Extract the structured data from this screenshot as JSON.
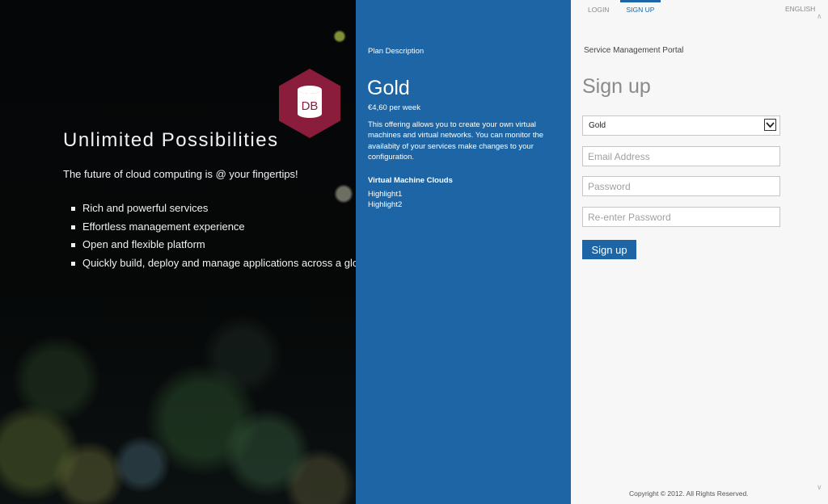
{
  "hero": {
    "badge": "DB",
    "title": "Unlimited Possibilities",
    "subtitle": "The future of cloud computing is @ your fingertips!",
    "features": [
      "Rich and powerful services",
      "Effortless management experience",
      "Open and flexible platform",
      "Quickly build, deploy and manage applications across a global"
    ]
  },
  "plan": {
    "section_label": "Plan Description",
    "name": "Gold",
    "price": "€4,60 per week",
    "description": "This offering allows you to create your own virtual machines and virtual networks. You can monitor the availabity of your services make changes to your configuration.",
    "feature_title": "Virtual Machine Clouds",
    "highlights": [
      "Highlight1",
      "Highlight2"
    ]
  },
  "nav": {
    "tabs": [
      {
        "label": "LOGIN",
        "active": false
      },
      {
        "label": "SIGN UP",
        "active": true
      }
    ],
    "language": "ENGLISH"
  },
  "signup": {
    "portal_name": "Service Management Portal",
    "title": "Sign up",
    "plan_select": {
      "selected": "Gold"
    },
    "email": {
      "placeholder": "Email Address",
      "value": ""
    },
    "password": {
      "placeholder": "Password",
      "value": ""
    },
    "confirm_password": {
      "placeholder": "Re-enter Password",
      "value": ""
    },
    "submit_label": "Sign up"
  },
  "footer": {
    "copyright": "Copyright © 2012. All Rights Reserved."
  },
  "colors": {
    "accent": "#1d65a4",
    "badge": "#8a1c3c"
  }
}
